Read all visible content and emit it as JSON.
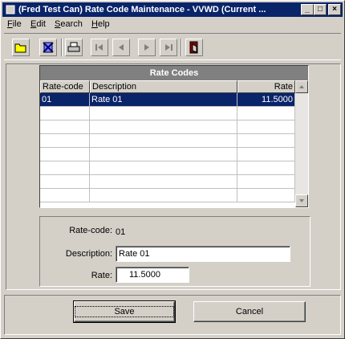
{
  "window": {
    "title": "(Fred Test Can) Rate Code Maintenance - VVWD (Current ...",
    "controls": {
      "minimize": "_",
      "maximize": "□",
      "close": "×"
    }
  },
  "menu": {
    "items": [
      {
        "label": "File",
        "accel": "F",
        "rest": "ile"
      },
      {
        "label": "Edit",
        "accel": "E",
        "rest": "dit"
      },
      {
        "label": "Search",
        "accel": "S",
        "rest": "earch"
      },
      {
        "label": "Help",
        "accel": "H",
        "rest": "elp"
      }
    ]
  },
  "toolbar": {
    "buttons": [
      "open-folder-icon",
      "delete-icon",
      "print-icon",
      "first-record-icon",
      "prev-record-icon",
      "next-record-icon",
      "last-record-icon",
      "exit-icon"
    ]
  },
  "grid": {
    "caption": "Rate Codes",
    "columns": [
      "Rate-code",
      "Description",
      "Rate"
    ],
    "rows": [
      {
        "code": "01",
        "description": "Rate 01",
        "rate": "11.5000"
      }
    ]
  },
  "detail": {
    "rate_code_label": "Rate-code:",
    "rate_code_value": "01",
    "description_label": "Description:",
    "description_value": "Rate 01",
    "rate_label": "Rate:",
    "rate_value": "11.5000"
  },
  "actions": {
    "save_label": "Save",
    "cancel_label": "Cancel"
  },
  "colors": {
    "titlebar": "#0a246a",
    "selection": "#0a246a",
    "face": "#d4d0c8"
  }
}
